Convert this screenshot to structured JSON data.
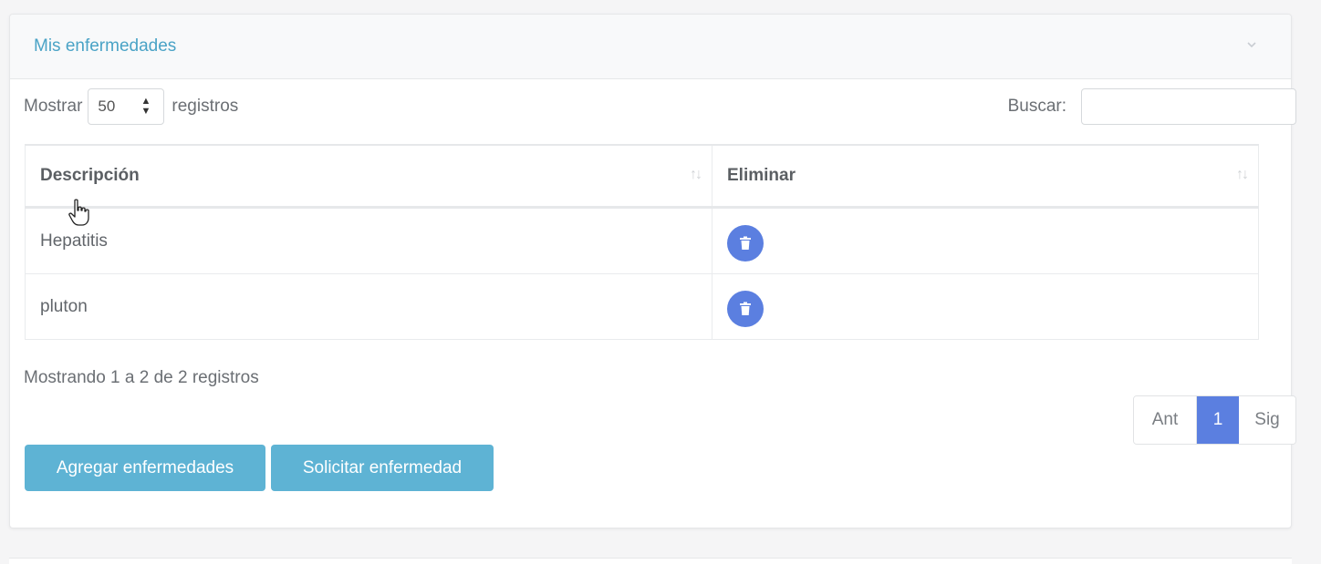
{
  "panel": {
    "title": "Mis enfermedades",
    "collapse_icon": "chevron-down-icon"
  },
  "length_control": {
    "prefix": "Mostrar",
    "selected": "50",
    "suffix": "registros"
  },
  "search": {
    "label": "Buscar:",
    "value": ""
  },
  "table": {
    "columns": [
      "Descripción",
      "Eliminar"
    ],
    "rows": [
      {
        "description": "Hepatitis",
        "action_icon": "trash-icon"
      },
      {
        "description": "pluton",
        "action_icon": "trash-icon"
      }
    ]
  },
  "info_text": "Mostrando 1 a 2 de 2 registros",
  "pagination": {
    "prev": "Ant",
    "current": "1",
    "next": "Sig"
  },
  "buttons": {
    "add": "Agregar enfermedades",
    "request": "Solicitar enfermedad"
  },
  "colors": {
    "accent_title": "#4aa3c6",
    "primary_blue": "#5b7fe0",
    "button_info": "#5eb3d4"
  }
}
